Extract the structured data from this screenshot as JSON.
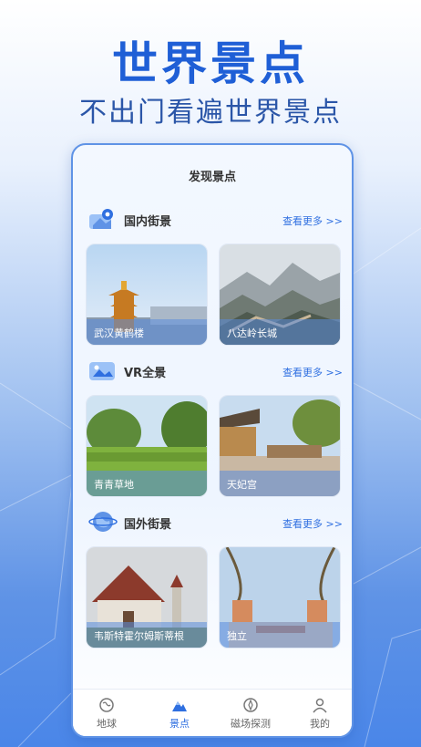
{
  "hero": {
    "title": "世界景点",
    "subtitle": "不出门看遍世界景点"
  },
  "phone": {
    "header": "发现景点",
    "sections": [
      {
        "title": "国内街景",
        "more": "查看更多 >>",
        "icon": "map-pin-icon",
        "cards": [
          {
            "label": "武汉黄鹤楼",
            "icon": "pagoda-photo"
          },
          {
            "label": "八达岭长城",
            "icon": "great-wall-photo"
          }
        ]
      },
      {
        "title": "VR全景",
        "more": "查看更多 >>",
        "icon": "vr-icon",
        "cards": [
          {
            "label": "青青草地",
            "icon": "grassland-photo"
          },
          {
            "label": "天妃宫",
            "icon": "temple-photo"
          }
        ]
      },
      {
        "title": "国外街景",
        "more": "查看更多 >>",
        "icon": "globe-icon",
        "cards": [
          {
            "label": "韦斯特霍尔姆斯蒂根",
            "icon": "church-photo"
          },
          {
            "label": "独立",
            "icon": "palace-photo"
          }
        ]
      }
    ],
    "tabbar": [
      {
        "label": "地球",
        "icon": "globe-tab-icon",
        "active": false
      },
      {
        "label": "景点",
        "icon": "mountain-tab-icon",
        "active": true
      },
      {
        "label": "磁场探测",
        "icon": "compass-tab-icon",
        "active": false
      },
      {
        "label": "我的",
        "icon": "user-tab-icon",
        "active": false
      }
    ]
  },
  "colors": {
    "accent": "#2f6fe0",
    "title": "#1f5fd6"
  }
}
